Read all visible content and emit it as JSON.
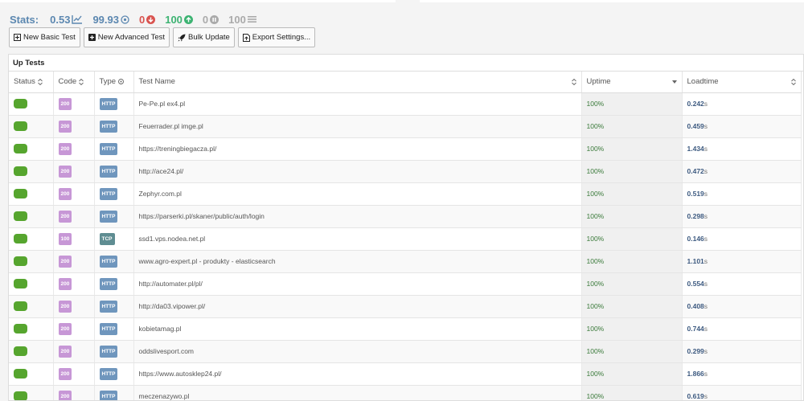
{
  "stats": {
    "label": "Stats:",
    "uptime_trend": "0.53",
    "uptime_avg": "99.93",
    "down": "0",
    "up": "100",
    "paused": "0",
    "total": "100",
    "colors": {
      "blue": "#5b87b0",
      "red": "#d9534f",
      "green": "#3db372",
      "grey": "#aaaaaa"
    }
  },
  "toolbar": {
    "new_basic": "New Basic Test",
    "new_advanced": "New Advanced Test",
    "bulk_update": "Bulk Update",
    "export": "Export Settings..."
  },
  "panel": {
    "title": "Up Tests"
  },
  "columns": {
    "status": "Status",
    "code": "Code",
    "type": "Type",
    "name": "Test Name",
    "uptime": "Uptime",
    "loadtime": "Loadtime"
  },
  "rows": [
    {
      "code": "200",
      "type": "HTTP",
      "name": "Pe-Pe.pl ex4.pl",
      "uptime": "100%",
      "load": "0.242",
      "unit": "s"
    },
    {
      "code": "200",
      "type": "HTTP",
      "name": "Feuerrader.pl imge.pl",
      "uptime": "100%",
      "load": "0.459",
      "unit": "s"
    },
    {
      "code": "200",
      "type": "HTTP",
      "name": "https://treningbiegacza.pl/",
      "uptime": "100%",
      "load": "1.434",
      "unit": "s"
    },
    {
      "code": "200",
      "type": "HTTP",
      "name": "http://ace24.pl/",
      "uptime": "100%",
      "load": "0.472",
      "unit": "s"
    },
    {
      "code": "200",
      "type": "HTTP",
      "name": "Zephyr.com.pl",
      "uptime": "100%",
      "load": "0.519",
      "unit": "s"
    },
    {
      "code": "200",
      "type": "HTTP",
      "name": "https://parserki.pl/skaner/public/auth/login",
      "uptime": "100%",
      "load": "0.298",
      "unit": "s"
    },
    {
      "code": "100",
      "type": "TCP",
      "name": "ssd1.vps.nodea.net.pl",
      "uptime": "100%",
      "load": "0.146",
      "unit": "s"
    },
    {
      "code": "200",
      "type": "HTTP",
      "name": "www.agro-expert.pl - produkty - elasticsearch",
      "uptime": "100%",
      "load": "1.101",
      "unit": "s"
    },
    {
      "code": "200",
      "type": "HTTP",
      "name": "http://automater.pl/pl/",
      "uptime": "100%",
      "load": "0.554",
      "unit": "s"
    },
    {
      "code": "200",
      "type": "HTTP",
      "name": "http://da03.vipower.pl/",
      "uptime": "100%",
      "load": "0.408",
      "unit": "s"
    },
    {
      "code": "200",
      "type": "HTTP",
      "name": "kobietamag.pl",
      "uptime": "100%",
      "load": "0.744",
      "unit": "s"
    },
    {
      "code": "200",
      "type": "HTTP",
      "name": "oddslivesport.com",
      "uptime": "100%",
      "load": "0.299",
      "unit": "s"
    },
    {
      "code": "200",
      "type": "HTTP",
      "name": "https://www.autosklep24.pl/",
      "uptime": "100%",
      "load": "1.866",
      "unit": "s"
    },
    {
      "code": "200",
      "type": "HTTP",
      "name": "meczenazywo.pl",
      "uptime": "100%",
      "load": "0.619",
      "unit": "s"
    }
  ]
}
